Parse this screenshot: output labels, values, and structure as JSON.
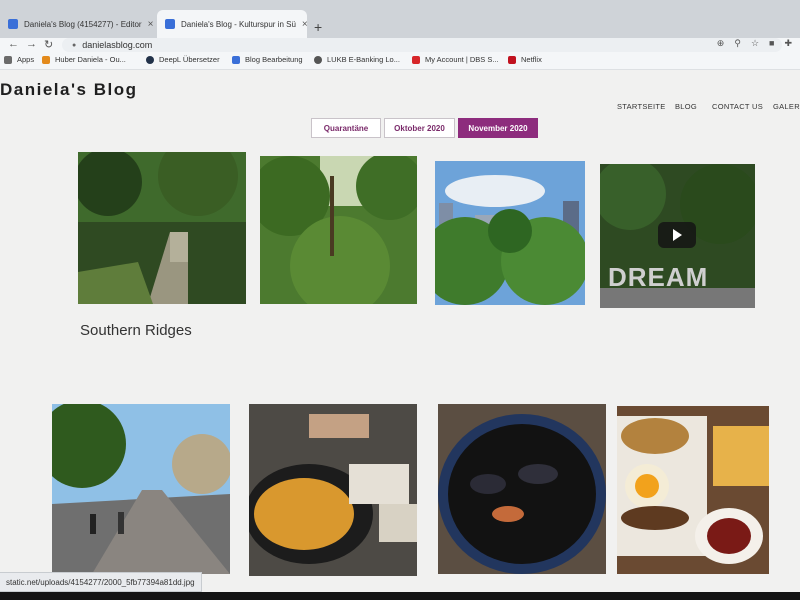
{
  "browser": {
    "tabs": [
      {
        "title": "Daniela's Blog (4154277) - Editor",
        "active": false
      },
      {
        "title": "Daniela's Blog - Kulturspur in Sü",
        "active": true
      }
    ],
    "new_tab_label": "+",
    "close_label": "×",
    "url": "danielasblog.com",
    "bookmarks": [
      "Apps",
      "Huber Daniela - Ou...",
      "DeepL Übersetzer",
      "Blog Bearbeitung",
      "LUKB E-Banking Lo...",
      "My Account | DBS S...",
      "Netflix"
    ],
    "status_url": "static.net/uploads/4154277/2000_5fb77394a81dd.jpg"
  },
  "site": {
    "title": "Daniela's Blog",
    "nav": [
      "STARTSEITE",
      "BLOG",
      "CONTACT US",
      "GALERIE"
    ],
    "filters": [
      {
        "label": "Quarantäne",
        "active": false
      },
      {
        "label": "Oktober 2020",
        "active": false
      },
      {
        "label": "November 2020",
        "active": true
      }
    ]
  },
  "gallery": {
    "title": "Southern Ridges",
    "overlay_text": "DREAM",
    "top_row": [
      "forest-stairs-photo",
      "jungle-photo",
      "skyline-trees-photo",
      "dream-sign-video"
    ],
    "bottom_row": [
      "boardwalk-photo",
      "fries-photo",
      "mussels-photo",
      "burger-photo"
    ]
  },
  "colors": {
    "accent": "#8d2c7d",
    "page_bg": "#f1f1f0"
  },
  "icons": [
    "back-icon",
    "forward-icon",
    "reload-icon",
    "lock-icon",
    "play-icon"
  ]
}
